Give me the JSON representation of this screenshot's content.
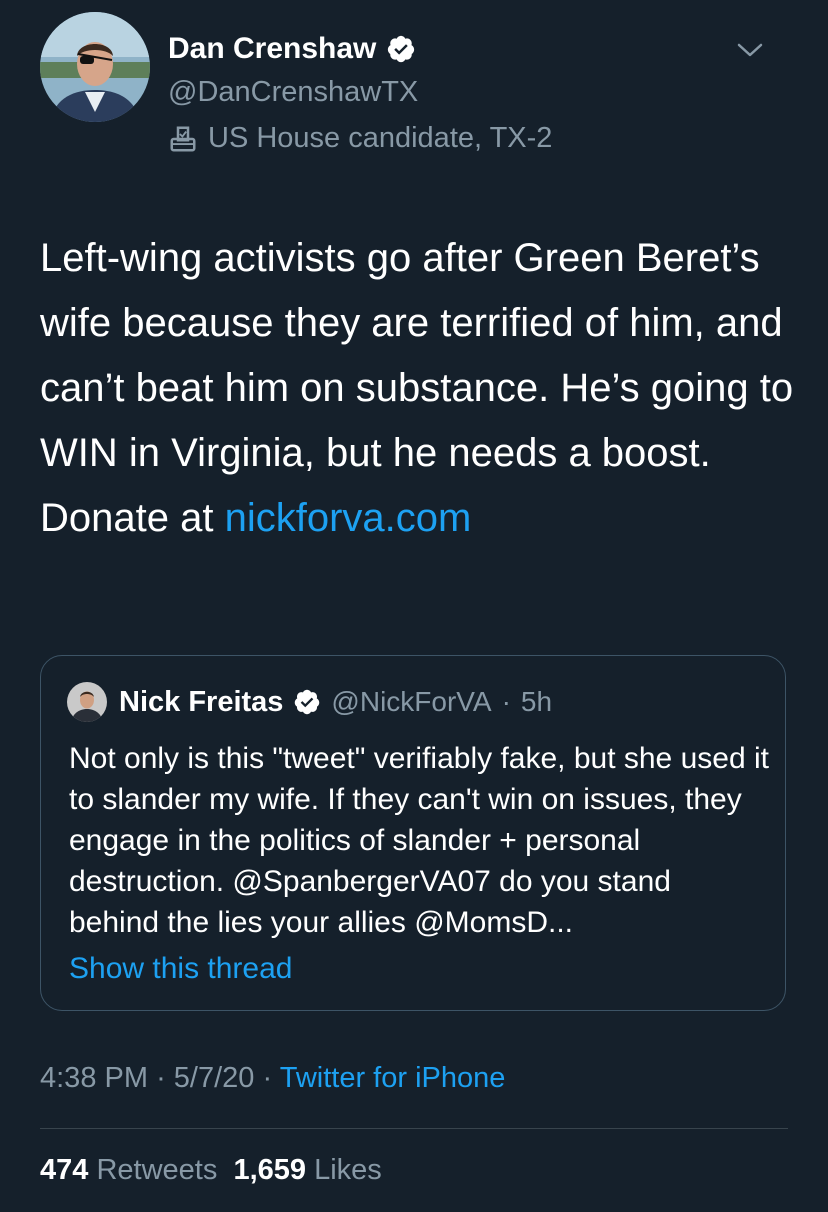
{
  "author": {
    "name": "Dan Crenshaw",
    "handle": "@DanCrenshawTX",
    "label": "US House candidate, TX-2"
  },
  "tweet": {
    "text": "Left-wing activists go after Green Beret’s wife because they are terrified of him, and can’t beat him on substance. He’s going to WIN in Virginia, but he needs a boost. Donate at ",
    "link": "nickforva.com"
  },
  "quote": {
    "name": "Nick Freitas",
    "handle": "@NickForVA",
    "separator": "·",
    "time": "5h",
    "text": "Not only is this \"tweet\" verifiably fake, but she used it to slander my wife. If they can't win on issues, they engage in the politics of slander + personal destruction. @SpanbergerVA07 do you stand behind the lies your allies @MomsD...",
    "show_thread": "Show this thread"
  },
  "meta": {
    "time": "4:38 PM",
    "sep1": "·",
    "date": "5/7/20",
    "sep2": "·",
    "source": "Twitter for iPhone"
  },
  "stats": {
    "retweets_count": "474",
    "retweets_label": "Retweets",
    "likes_count": "1,659",
    "likes_label": "Likes"
  },
  "colors": {
    "background": "#15202b",
    "accent": "#1da1f2",
    "secondary_text": "#8899a6",
    "border": "#38444d"
  }
}
